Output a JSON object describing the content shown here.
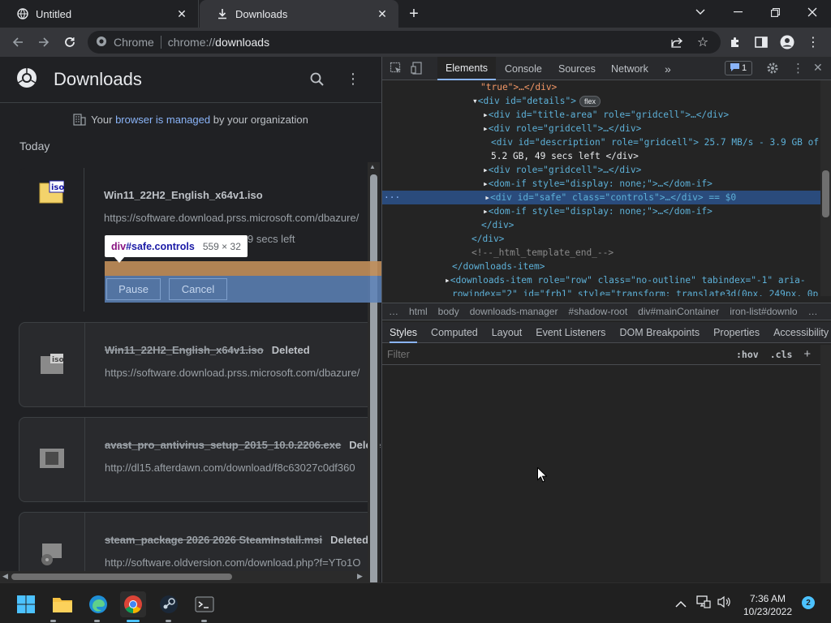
{
  "tabs": [
    {
      "label": "Untitled",
      "active": false
    },
    {
      "label": "Downloads",
      "active": true
    }
  ],
  "omnibox": {
    "chip": "Chrome",
    "scheme": "chrome://",
    "path": "downloads"
  },
  "downloads": {
    "title": "Downloads",
    "managed_prefix": "Your ",
    "managed_link": "browser is managed",
    "managed_suffix": " by your organization",
    "section": "Today",
    "items": [
      {
        "name": "Win11_22H2_English_x64v1.iso",
        "url": "https://software.download.prss.microsoft.com/dbazure/",
        "progress": "9 secs left",
        "deleted": ""
      },
      {
        "name": "Win11_22H2_English_x64v1.iso",
        "url": "https://software.download.prss.microsoft.com/dbazure/",
        "deleted": "Deleted"
      },
      {
        "name": "avast_pro_antivirus_setup_2015_10.0.2206.exe",
        "url": "http://dl15.afterdawn.com/download/f8c63027c0df360",
        "deleted": "Delete"
      },
      {
        "name": "steam_package 2026 2026 SteamInstall.msi",
        "url": "http://software.oldversion.com/download.php?f=YTo1O",
        "deleted": "Deleted"
      }
    ],
    "buttons": {
      "pause": "Pause",
      "cancel": "Cancel"
    },
    "tooltip": {
      "tag": "div",
      "cls": "#safe.controls",
      "size": "559 × 32"
    }
  },
  "devtools": {
    "tabs": [
      "Elements",
      "Console",
      "Sources",
      "Network",
      "»"
    ],
    "issues_count": "1",
    "dom_lines": {
      "l0": "\"true\">…</div>",
      "l1a": "<div id=\"details\">",
      "l1b": "flex",
      "l2": "<div id=\"title-area\" role=\"gridcell\">…</div>",
      "l3": "<div role=\"gridcell\">…</div>",
      "l4": "<div id=\"description\" role=\"gridcell\"> 25.7 MB/s - 3.9 GB of",
      "l5": "5.2 GB, 49 secs left </div>",
      "l6": "<div role=\"gridcell\">…</div>",
      "l7": "<dom-if style=\"display: none;\">…</dom-if>",
      "l8": "<div id=\"safe\" class=\"controls\">…</div> == $0",
      "l9": "<dom-if style=\"display: none;\">…</dom-if>",
      "l10": "</div>",
      "l11": "</div>",
      "l12": "<!--_html_template_end_-->",
      "l13": "</downloads-item>",
      "l14": "<downloads-item role=\"row\" class=\"no-outline\" tabindex=\"-1\" aria-",
      "l15": "rowindex=\"2\" id=\"frb1\" style=\"transform: translate3d(0px, 249px, 0p"
    },
    "breadcrumbs": [
      "…",
      "html",
      "body",
      "downloads-manager",
      "#shadow-root",
      "div#mainContainer",
      "iron-list#downlo",
      "…"
    ],
    "subtabs": [
      "Styles",
      "Computed",
      "Layout",
      "Event Listeners",
      "DOM Breakpoints",
      "Properties",
      "Accessibility"
    ],
    "filter_placeholder": "Filter",
    "hov": ":hov",
    "cls": ".cls",
    "plus": "+"
  },
  "taskbar": {
    "time": "7:36 AM",
    "date": "10/23/2022",
    "badge": "2"
  },
  "colors": {
    "accent": "#8ab4f8",
    "selection": "#2a4b7c",
    "highlight_content": "#5d83b9",
    "highlight_margin": "#c18e5a"
  }
}
